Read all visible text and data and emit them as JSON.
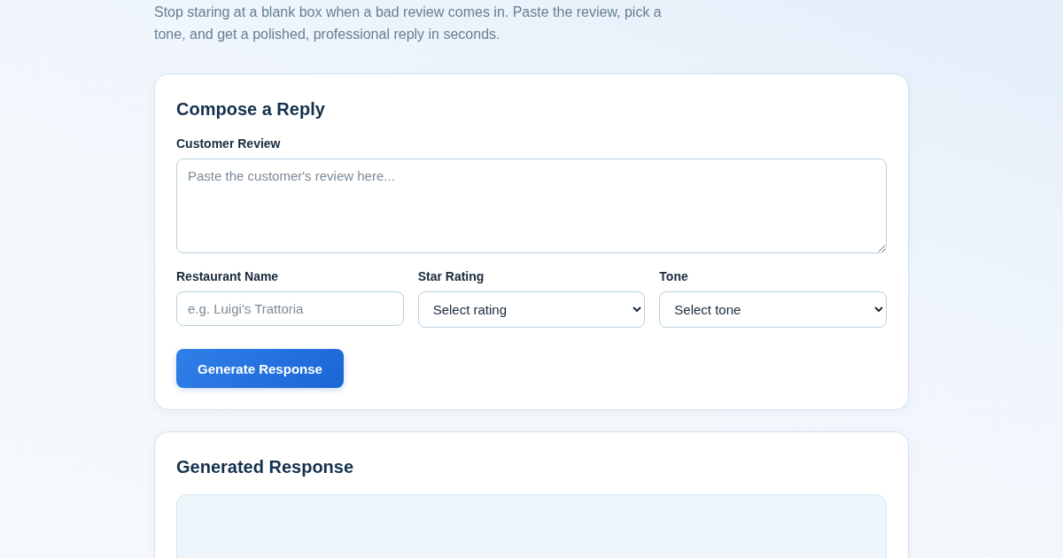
{
  "intro": "Stop staring at a blank box when a bad review comes in. Paste the review, pick a tone, and get a polished, professional reply in seconds.",
  "compose": {
    "title": "Compose a Reply",
    "review": {
      "label": "Customer Review",
      "placeholder": "Paste the customer's review here..."
    },
    "restaurant": {
      "label": "Restaurant Name",
      "placeholder": "e.g. Luigi's Trattoria"
    },
    "rating": {
      "label": "Star Rating",
      "value": "Select rating"
    },
    "tone": {
      "label": "Tone",
      "value": "Select tone"
    },
    "button": "Generate Response"
  },
  "generated": {
    "title": "Generated Response"
  }
}
